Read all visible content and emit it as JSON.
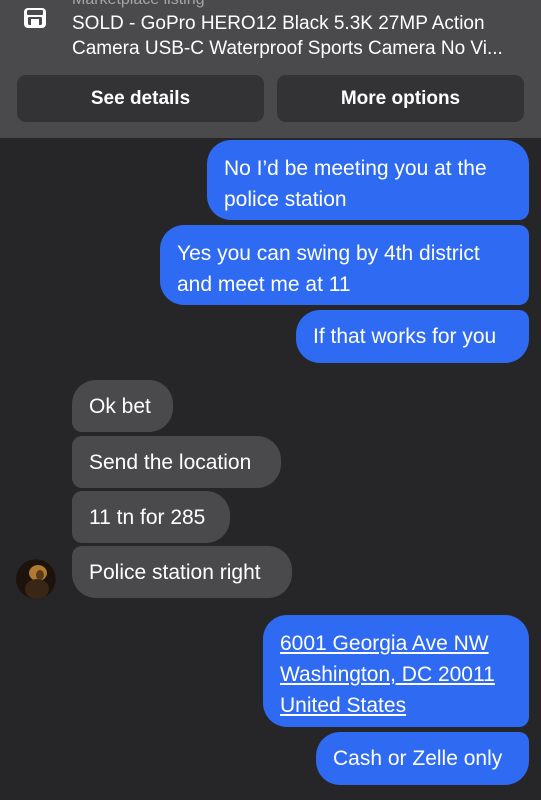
{
  "listing": {
    "label": "Marketplace listing",
    "title": "SOLD - GoPro HERO12 Black 5.3K 27MP Action Camera USB-C Waterproof Sports Camera No Vi...",
    "icon": "store-icon"
  },
  "actions": {
    "see_details": "See details",
    "more_options": "More options"
  },
  "messages": {
    "out1_line1": "No I’d be meeting you at the",
    "out1_line2": "police station",
    "out2_line1": "Yes you can swing by 4th district",
    "out2_line2": "and meet me at 11",
    "out3": "If that works for you",
    "in1": "Ok bet",
    "in2": "Send the location",
    "in3": "11 tn for 285",
    "in4": "Police station right",
    "address_line1": "6001 Georgia Ave NW",
    "address_line2": "Washington, DC  20011",
    "address_line3": "United States",
    "out5": "Cash or Zelle only"
  },
  "colors": {
    "background": "#262628",
    "outgoing_bubble": "#2f6af2",
    "incoming_bubble": "#4a4a4c",
    "header": "#4a4a4c",
    "button": "#333335"
  }
}
